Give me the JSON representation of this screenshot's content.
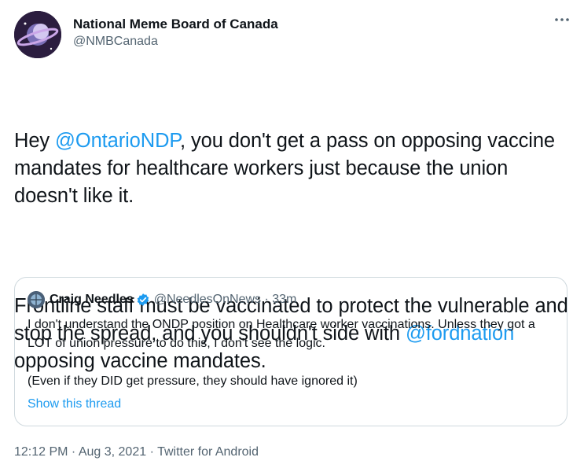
{
  "author": {
    "display_name": "National Meme Board of Canada",
    "handle": "@NMBCanada",
    "avatar_icon": "planet-logo-avatar"
  },
  "more_icon": "more-options-icon",
  "tweet": {
    "p1_before": "Hey ",
    "p1_mention": "@OntarioNDP",
    "p1_after": ", you don't get a pass on opposing vaccine mandates for healthcare workers just because the union doesn't like it.",
    "p2_before": "Frontline staff must be vaccinated to protect the vulnerable and stop the spread, and you shouldn't side with ",
    "p2_mention": "@fordnation",
    "p2_after": " opposing vaccine mandates."
  },
  "quote": {
    "display_name": "Craig Needles",
    "verified_icon": "verified-badge-icon",
    "handle_time": "@NeedlesOnNews · 33m",
    "p1": "I don't understand the ONDP position on Healthcare worker vaccinations. Unless they got a LOT of union pressure to do this, I don't see the logic.",
    "p2": "(Even if they DID get pressure, they should have ignored it)",
    "show_thread": "Show this thread"
  },
  "meta": {
    "time": "12:12 PM",
    "date": "Aug 3, 2021",
    "source": "Twitter for Android",
    "sep": " · "
  },
  "colors": {
    "link": "#1d9bf0",
    "secondary": "#536471",
    "text": "#0f1419",
    "border": "#cfd9de"
  }
}
